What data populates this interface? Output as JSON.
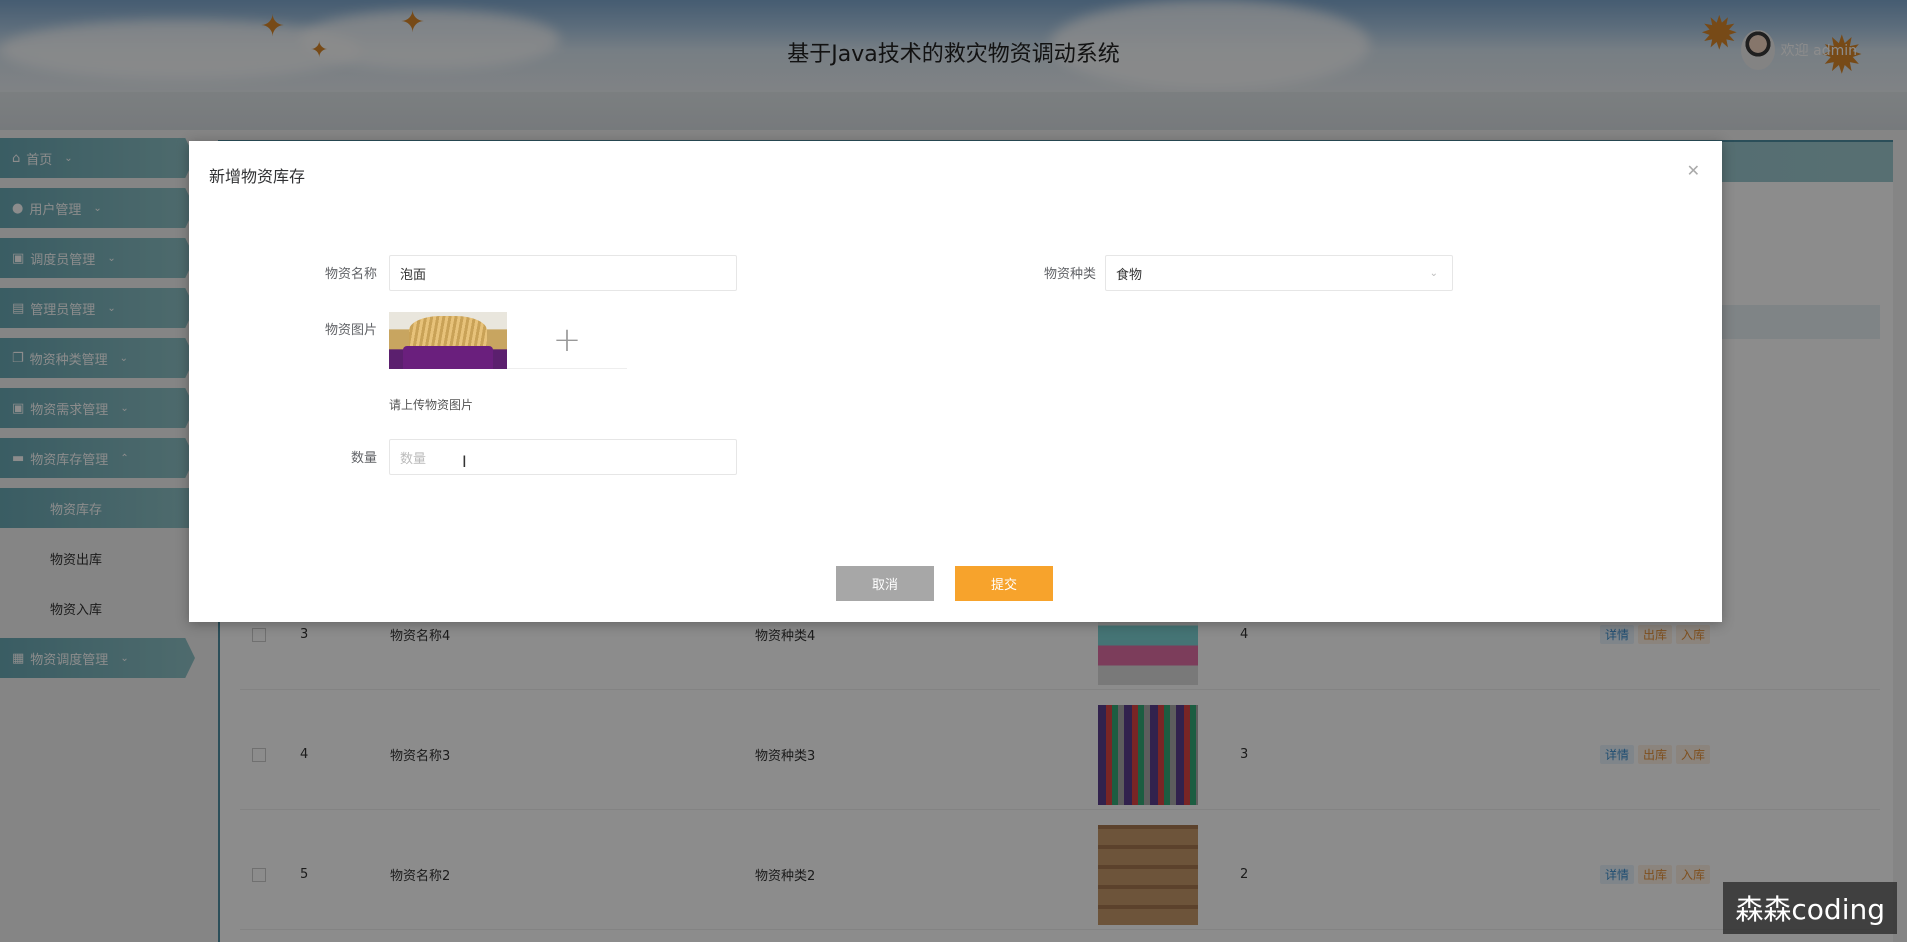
{
  "header": {
    "title": "基于Java技术的救灾物资调动系统",
    "user_greeting": "欢迎 admin"
  },
  "sidebar": {
    "items": [
      {
        "label": "首页",
        "icon": "home-icon"
      },
      {
        "label": "用户管理",
        "icon": "user-icon"
      },
      {
        "label": "调度员管理",
        "icon": "briefcase-icon"
      },
      {
        "label": "管理员管理",
        "icon": "card-icon"
      },
      {
        "label": "物资种类管理",
        "icon": "docs-icon"
      },
      {
        "label": "物资需求管理",
        "icon": "briefcase-icon"
      },
      {
        "label": "物资库存管理",
        "icon": "box-icon"
      }
    ],
    "submenu": [
      {
        "label": "物资库存",
        "active": true
      },
      {
        "label": "物资出库",
        "active": false
      },
      {
        "label": "物资入库",
        "active": false
      }
    ],
    "last_item": {
      "label": "物资调度管理",
      "icon": "dispatch-icon"
    }
  },
  "table": {
    "rows": [
      {
        "index": "3",
        "name": "物资名称4",
        "type": "物资种类4",
        "qty": "4"
      },
      {
        "index": "4",
        "name": "物资名称3",
        "type": "物资种类3",
        "qty": "3"
      },
      {
        "index": "5",
        "name": "物资名称2",
        "type": "物资种类2",
        "qty": "2"
      }
    ],
    "ops": {
      "detail": "详情",
      "out": "出库",
      "in": "入库"
    }
  },
  "modal": {
    "title": "新增物资库存",
    "fields": {
      "name_label": "物资名称",
      "name_value": "泡面",
      "type_label": "物资种类",
      "type_value": "食物",
      "image_label": "物资图片",
      "image_hint": "请上传物资图片",
      "qty_label": "数量",
      "qty_placeholder": "数量"
    },
    "cancel_label": "取消",
    "submit_label": "提交"
  },
  "watermark": "森森coding",
  "colors": {
    "accent": "#6aa9b5",
    "submit": "#f7a32c",
    "cancel": "#a7a7a7"
  }
}
